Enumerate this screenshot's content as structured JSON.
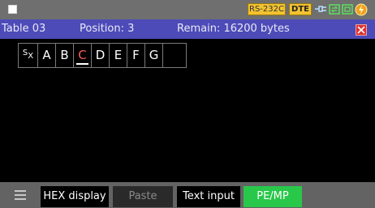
{
  "status": {
    "rs232c_label": "RS-232C",
    "dte_label": "DTE",
    "icons": [
      "window-icon",
      "connector-icon",
      "link-icon",
      "memory-card-icon",
      "power-icon"
    ]
  },
  "title": {
    "table": "Table 03",
    "position": "Position: 3",
    "remain": "Remain: 16200 bytes"
  },
  "tabs": [
    {
      "label": "S",
      "sub": "X",
      "id": "sx"
    },
    {
      "label": "A"
    },
    {
      "label": "B"
    },
    {
      "label": "C",
      "active": true
    },
    {
      "label": "D"
    },
    {
      "label": "E"
    },
    {
      "label": "F"
    },
    {
      "label": "G"
    },
    {
      "label": ""
    }
  ],
  "toolbar": {
    "hex_label": "HEX display",
    "paste_label": "Paste",
    "text_input_label": "Text input",
    "pemp_label": "PE/MP"
  },
  "colors": {
    "title_bar": "#4d4bb8",
    "status_bar": "#6f6f6f",
    "badge": "#f2c230",
    "accent_green": "#29c74a",
    "close_red": "#e03030",
    "active_tab_text": "#ff5a5a"
  }
}
